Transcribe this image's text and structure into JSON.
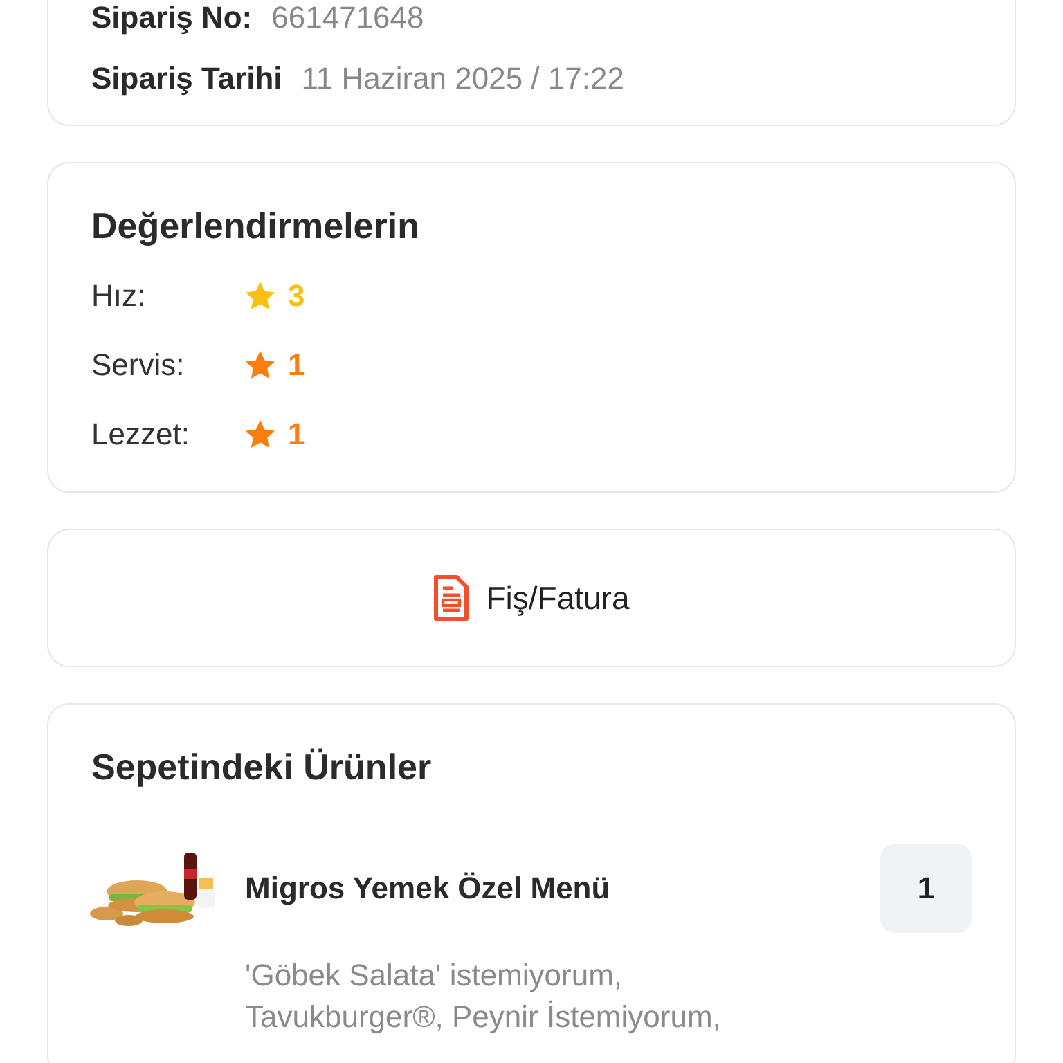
{
  "order_info": {
    "rows": [
      {
        "label": "Sipariş No:",
        "value": "661471648"
      },
      {
        "label": "Sipariş Tarihi",
        "value": "11 Haziran 2025 / 17:22"
      }
    ]
  },
  "ratings": {
    "title": "Değerlendirmelerin",
    "items": [
      {
        "label": "Hız:",
        "value": "3",
        "color": "#fbbf0f"
      },
      {
        "label": "Servis:",
        "value": "1",
        "color": "#fb7d0c"
      },
      {
        "label": "Lezzet:",
        "value": "1",
        "color": "#fb7d0c"
      }
    ]
  },
  "receipt_button": {
    "label": "Fiş/Fatura"
  },
  "basket": {
    "title": "Sepetindeki Ürünler",
    "items": [
      {
        "name": "Migros Yemek Özel Menü",
        "quantity": "1",
        "note": "'Göbek Salata' istemiyorum, Tavukburger®, Peynir İstemiyorum,"
      }
    ]
  }
}
